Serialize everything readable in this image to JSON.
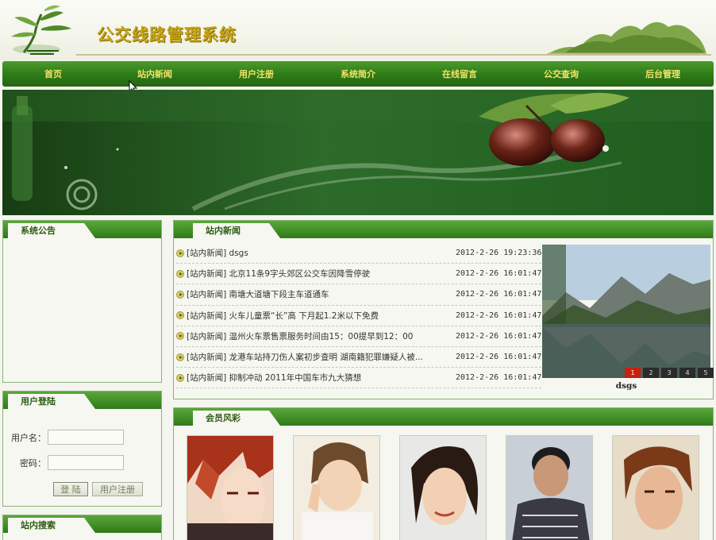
{
  "header": {
    "site_title": "公交线路管理系统"
  },
  "nav": {
    "items": [
      {
        "label": "首页"
      },
      {
        "label": "站内新闻"
      },
      {
        "label": "用户注册"
      },
      {
        "label": "系统简介"
      },
      {
        "label": "在线留言"
      },
      {
        "label": "公交查询"
      },
      {
        "label": "后台管理"
      }
    ]
  },
  "notice": {
    "title": "系统公告"
  },
  "login": {
    "title": "用户登陆",
    "username_label": "用户名：",
    "username_value": "",
    "password_label": "密码：",
    "password_value": "",
    "login_button": "登 陆",
    "register_button": "用户注册"
  },
  "search": {
    "title": "站内搜索"
  },
  "news": {
    "title": "站内新闻",
    "items": [
      {
        "title": "[站内新闻] dsgs",
        "date": "2012-2-26 19:23:36"
      },
      {
        "title": "[站内新闻] 北京11条9字头郊区公交车因降雪停驶",
        "date": "2012-2-26 16:01:47"
      },
      {
        "title": "[站内新闻] 南塘大道塘下段主车道通车",
        "date": "2012-2-26 16:01:47"
      },
      {
        "title": "[站内新闻] 火车儿童票“长”高 下月起1.2米以下免费",
        "date": "2012-2-26 16:01:47"
      },
      {
        "title": "[站内新闻] 温州火车票售票服务时间由15：00提早到12：00",
        "date": "2012-2-26 16:01:47"
      },
      {
        "title": "[站内新闻] 龙港车站持刀伤人案初步查明 湖南籍犯罪嫌疑人被...",
        "date": "2012-2-26 16:01:47"
      },
      {
        "title": "[站内新闻] 抑制冲动 2011年中国车市九大猜想",
        "date": "2012-2-26 16:01:47"
      }
    ],
    "photo_caption": "dsgs",
    "pager": [
      "1",
      "2",
      "3",
      "4",
      "5"
    ]
  },
  "members": {
    "title": "会员风彩"
  },
  "colors": {
    "nav_green": "#2e7a18",
    "nav_text": "#f4e36a",
    "title_gold": "#c8a311"
  }
}
